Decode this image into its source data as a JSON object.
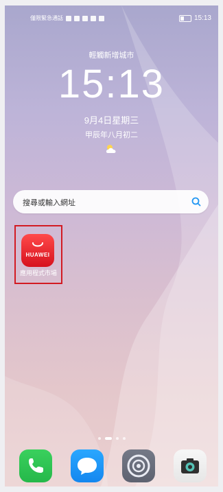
{
  "status_bar": {
    "left_text": "僅限緊急通話",
    "time": "15:13"
  },
  "lockscreen": {
    "location": "輕觸新增城市",
    "clock": "15:13",
    "date": "9月4日星期三",
    "lunar_date": "甲辰年八月初二",
    "weather_icon": "partly-cloudy-icon"
  },
  "search": {
    "placeholder": "搜尋或輸入網址",
    "icon": "search-icon"
  },
  "apps": [
    {
      "icon_text": "HUAWEI",
      "label": "應用程式市場"
    }
  ],
  "page_indicator": {
    "pages": 4,
    "active_index": 1
  },
  "dock": [
    {
      "name": "phone",
      "icon": "phone-icon"
    },
    {
      "name": "messages",
      "icon": "message-icon"
    },
    {
      "name": "settings",
      "icon": "settings-gear-icon"
    },
    {
      "name": "camera",
      "icon": "camera-icon"
    }
  ],
  "colors": {
    "highlight": "#d21a22",
    "app_red": "#e8202c",
    "search_accent": "#2196f3"
  }
}
